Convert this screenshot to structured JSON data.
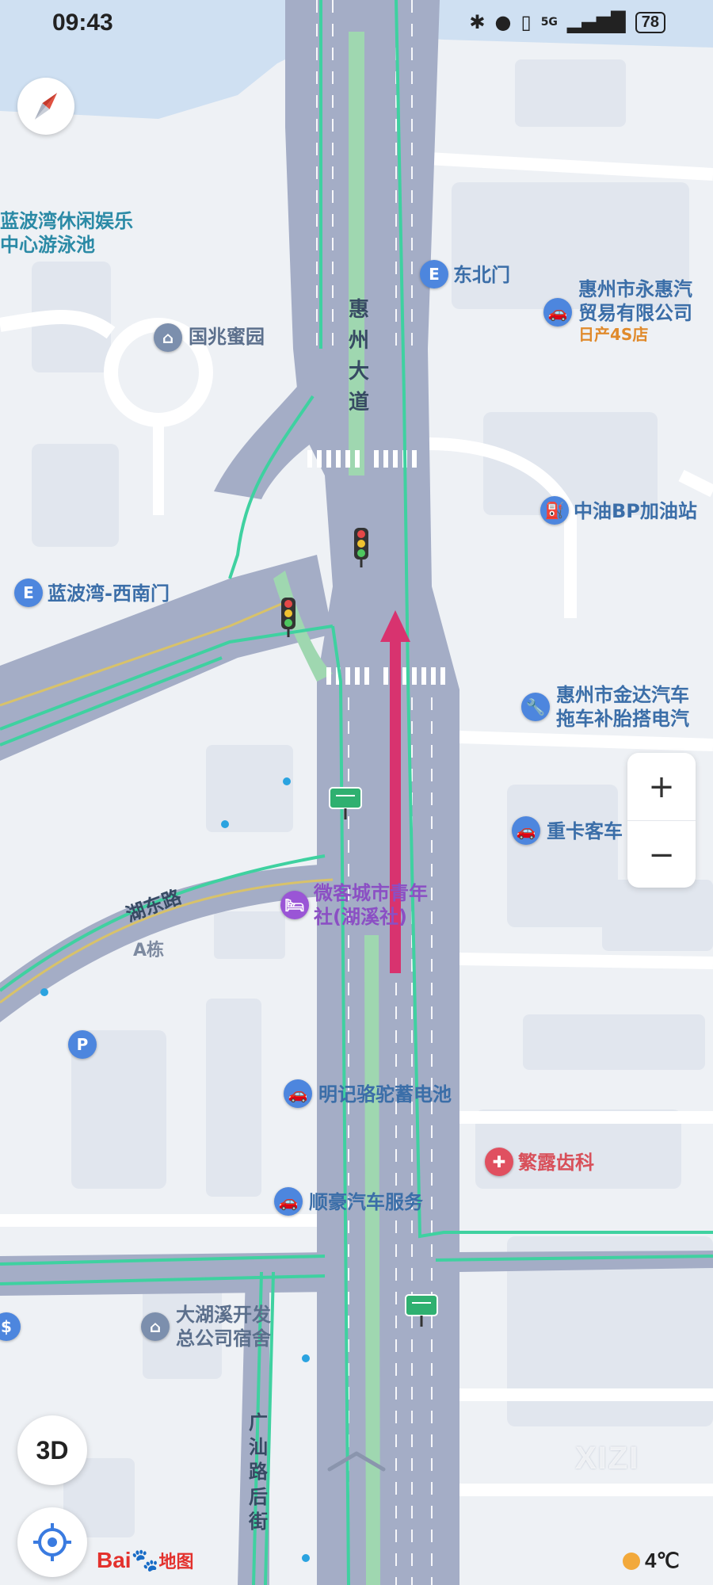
{
  "status_bar": {
    "time": "09:43",
    "battery": "78",
    "network": "5G"
  },
  "map": {
    "roads": {
      "main_avenue": "惠州大道",
      "hudong_road": "湖东路",
      "guangshan_rear": "广汕路后街"
    },
    "pois": {
      "lanbowan_leisure_1": "蓝波湾休闲娱乐",
      "lanbowan_leisure_2": "中心游泳池",
      "guozhao": "国兆蜜园",
      "northeast_gate": "东北门",
      "yonghui_1": "惠州市永惠汽",
      "yonghui_2": "贸易有限公司",
      "nissan": "日产4S店",
      "bp_station": "中油BP加油站",
      "lanbowan_west_gate": "蓝波湾-西南门",
      "jinda_1": "惠州市金达汽车",
      "jinda_2": "拖车补胎搭电汽",
      "heavy_truck": "重卡客车",
      "hostel_1": "微客城市青年",
      "hostel_2": "社(湖溪社)",
      "building_a": "A栋",
      "mingji": "明记骆驼蓄电池",
      "dental": "繁露齿科",
      "shunhao": "顺豪汽车服务",
      "dormitory_1": "大湖溪开发",
      "dormitory_2": "总公司宿舍"
    },
    "parking_symbol": "P"
  },
  "controls": {
    "zoom_in": "+",
    "zoom_out": "−",
    "view_3d": "3D"
  },
  "branding": {
    "logo_text_1": "Bai",
    "logo_text_2": "地图",
    "watermark": "XIZI"
  },
  "weather": {
    "temperature": "4℃"
  },
  "colors": {
    "route_arrow": "#d8336f",
    "road": "#a4adc6",
    "route_line": "#3fd1a0",
    "water": "#cfe0f2"
  }
}
